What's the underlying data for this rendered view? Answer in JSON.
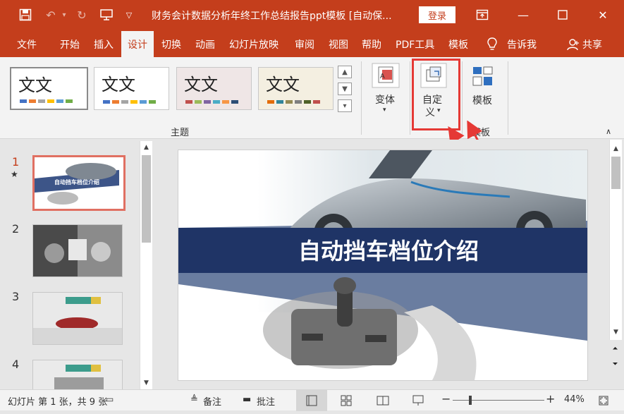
{
  "window": {
    "title": "财务会计数据分析年终工作总结报告ppt模板 [自动保...",
    "login_label": "登录",
    "icons": [
      "save-icon",
      "undo-icon",
      "redo-icon",
      "present-icon",
      "customize-qat-icon",
      "ribbon-display-icon",
      "minimize-icon",
      "maximize-icon",
      "close-icon"
    ]
  },
  "menu": {
    "tabs": [
      "文件",
      "开始",
      "插入",
      "设计",
      "切换",
      "动画",
      "幻灯片放映",
      "审阅",
      "视图",
      "帮助",
      "PDF工具",
      "模板"
    ],
    "active": "设计",
    "tell_me": "告诉我",
    "share": "共享"
  },
  "ribbon": {
    "themes_group_label": "主题",
    "theme_sample_text": "文文",
    "themes": [
      {
        "text": "文文",
        "swatches": [
          "#4472c4",
          "#ed7d31",
          "#a5a5a5",
          "#ffc000",
          "#5b9bd5",
          "#70ad47"
        ]
      },
      {
        "text": "文文",
        "swatches": [
          "#4472c4",
          "#ed7d31",
          "#a5a5a5",
          "#ffc000",
          "#5b9bd5",
          "#70ad47"
        ]
      },
      {
        "text": "文文",
        "swatches": [
          "#c0504d",
          "#9bbb59",
          "#8064a2",
          "#4bacc6",
          "#f79646",
          "#2c4d75"
        ]
      },
      {
        "text": "文文",
        "swatches": [
          "#e36c09",
          "#31859b",
          "#948a54",
          "#7f7f7f",
          "#4f6228",
          "#c0504d"
        ]
      }
    ],
    "variants_label": "变体",
    "customize_label_line1": "自定",
    "customize_label_line2": "义",
    "template_button_label": "模板",
    "template_group_label": "模板"
  },
  "slides": {
    "numbers": [
      "1",
      "2",
      "3",
      "4"
    ],
    "thumb1_title": "自动挡车档位介绍"
  },
  "main_slide": {
    "title": "自动挡车档位介绍",
    "banner_color": "#1f3466"
  },
  "status": {
    "slide_info": "幻灯片 第 1 张，共 9 张",
    "notes_label": "备注",
    "comments_label": "批注",
    "zoom": "44%"
  }
}
